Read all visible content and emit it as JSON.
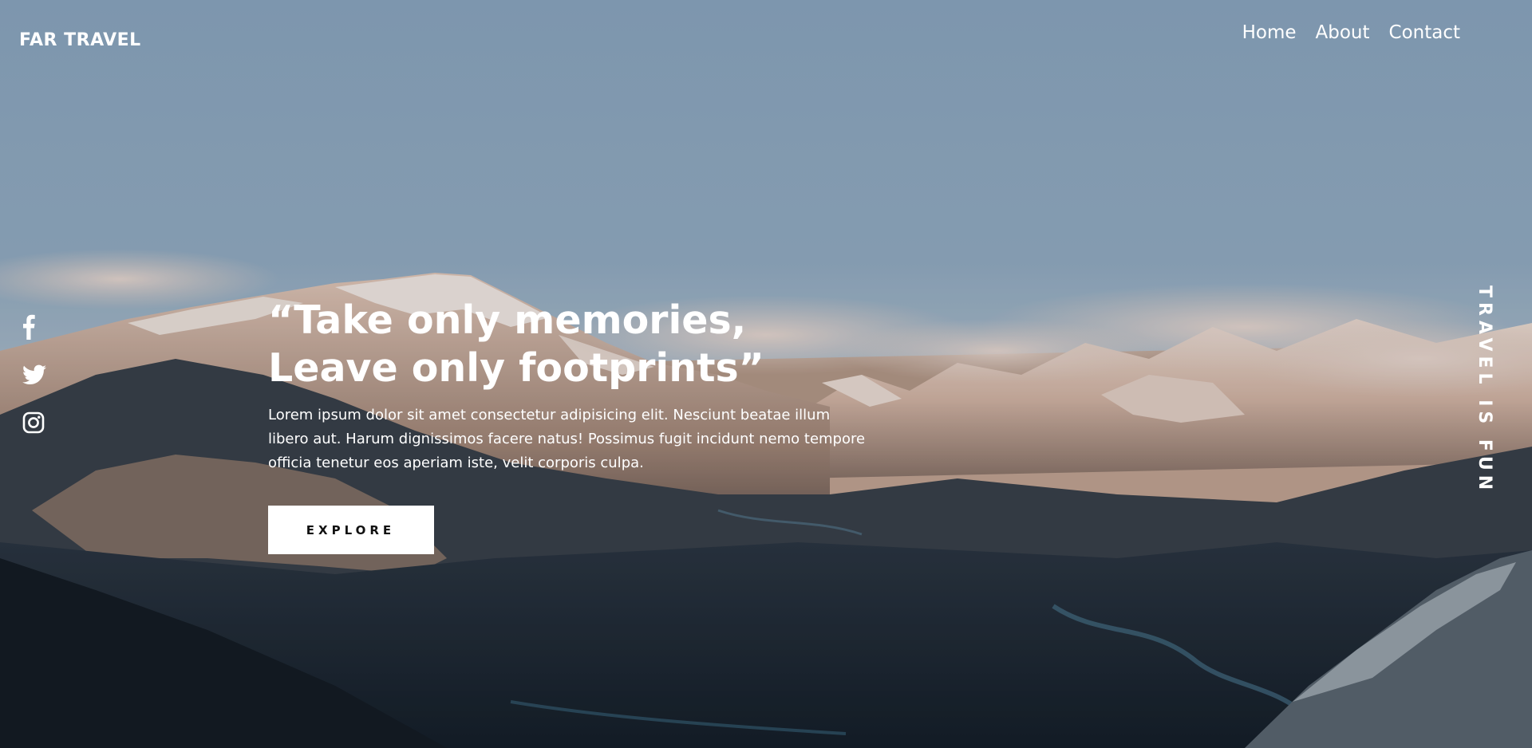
{
  "site": {
    "logo": "FAR TRAVEL"
  },
  "nav": {
    "items": [
      {
        "label": "Home"
      },
      {
        "label": "About"
      },
      {
        "label": "Contact"
      }
    ]
  },
  "socials": [
    {
      "icon": "facebook-icon"
    },
    {
      "icon": "twitter-icon"
    },
    {
      "icon": "instagram-icon"
    }
  ],
  "hero": {
    "quote_line1": "“Take only memories,",
    "quote_line2": "Leave only footprints”",
    "description": "Lorem ipsum dolor sit amet consectetur adipisicing elit. Nesciunt beatae illum libero aut. Harum dignissimos facere natus! Possimus fugit incidunt nemo tempore officia tenetur eos aperiam iste, velit corporis culpa.",
    "cta_label": "EXPLORE"
  },
  "tagline": "TRAVEL IS FUN",
  "colors": {
    "sky_top": "#8fa9c2",
    "sky_horizon": "#b9c6d2",
    "snow_lit": "#f1d9cc",
    "valley_dark": "#1b2733",
    "text": "#ffffff",
    "button_bg": "#ffffff",
    "button_text": "#111111"
  }
}
